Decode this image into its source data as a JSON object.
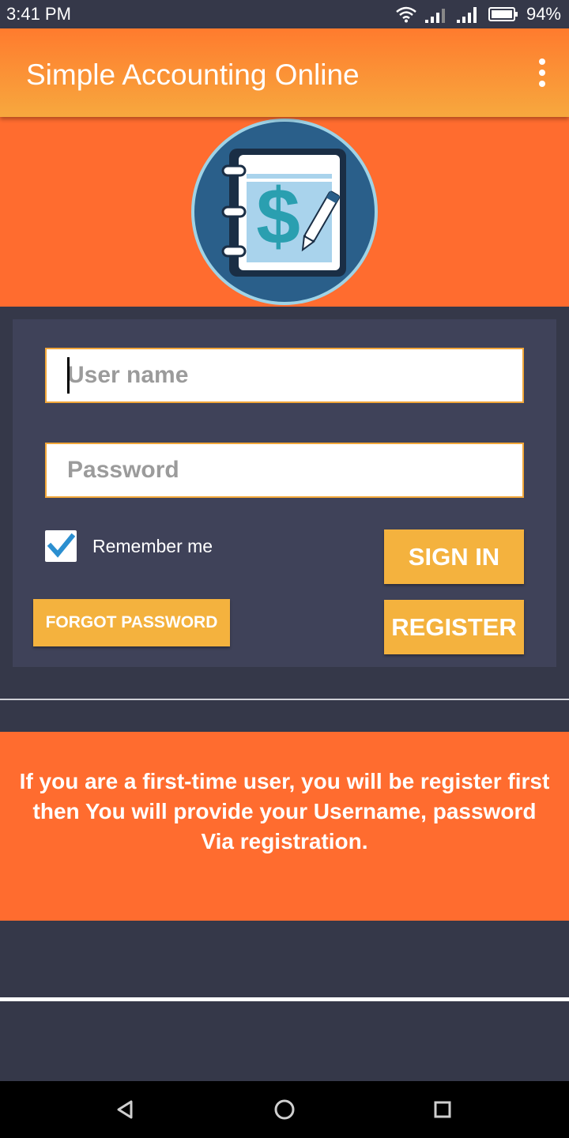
{
  "status_bar": {
    "time": "3:41 PM",
    "battery": "94%"
  },
  "app_bar": {
    "title": "Simple Accounting Online",
    "menu_icon": "more-vert-icon"
  },
  "logo": {
    "icon": "accounting-notebook-logo",
    "symbol": "$"
  },
  "login_form": {
    "username_placeholder": "User name",
    "username_value": "",
    "password_placeholder": "Password",
    "password_value": "",
    "remember_me": {
      "label": "Remember me",
      "checked": true
    },
    "sign_in_label": "SIGN IN",
    "register_label": "REGISTER",
    "forgot_password_label": "FORGOT PASSWORD"
  },
  "info_banner": {
    "text": "If you are a first-time user, you will be register first then You will provide your Username, password Via registration."
  },
  "nav_bar": {
    "back_icon": "back-triangle-icon",
    "home_icon": "home-circle-icon",
    "recents_icon": "recents-square-icon"
  },
  "colors": {
    "accent_orange": "#ff6c2f",
    "button_yellow": "#f4b23e",
    "card_bg": "#3f4259",
    "page_bg": "#353849",
    "logo_blue": "#2a5f8a"
  }
}
